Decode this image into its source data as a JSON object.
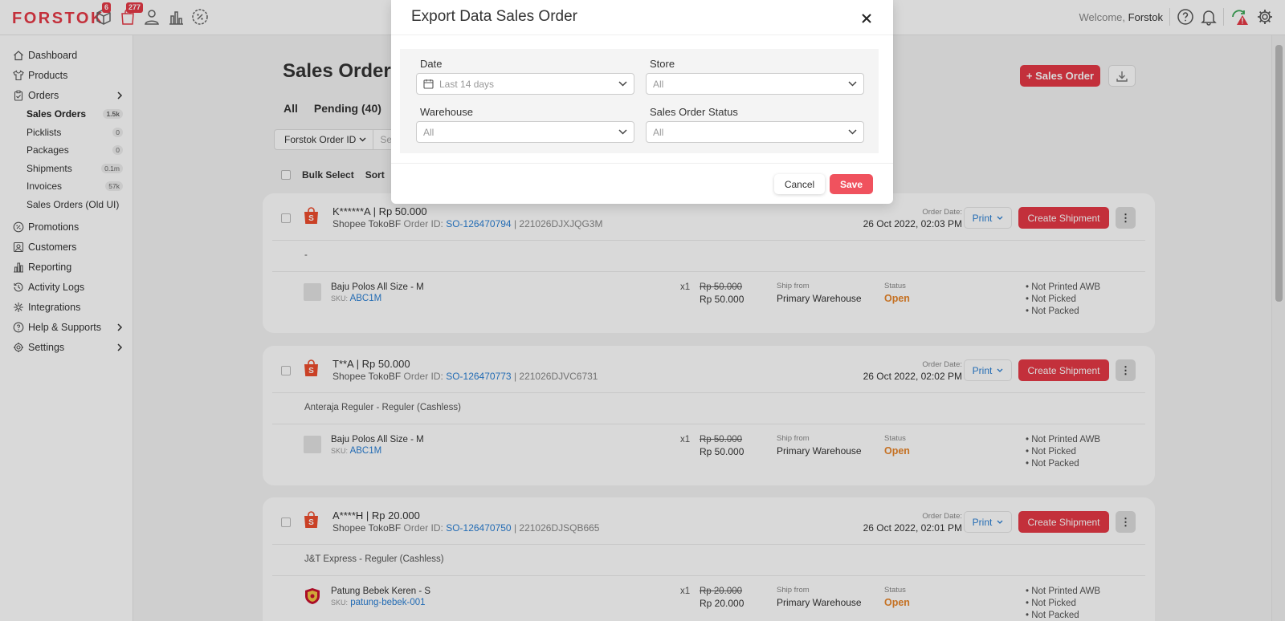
{
  "app": {
    "logo": "FORSTOK",
    "brand_color": "#e63946",
    "badges": {
      "box": "6",
      "bag": "277"
    },
    "welcome_prefix": "Welcome,",
    "welcome_user": "Forstok"
  },
  "sidebar": {
    "items": [
      {
        "label": "Dashboard",
        "icon": "home-icon"
      },
      {
        "label": "Products",
        "icon": "shirt-icon"
      },
      {
        "label": "Orders",
        "icon": "clipboard-icon"
      }
    ],
    "subitems": [
      {
        "label": "Sales Orders",
        "count": "1.5k"
      },
      {
        "label": "Picklists",
        "count": "0"
      },
      {
        "label": "Packages",
        "count": "0"
      },
      {
        "label": "Shipments",
        "count": "0.1m"
      },
      {
        "label": "Invoices",
        "count": "57k"
      },
      {
        "label": "Sales Orders (Old UI)",
        "count": ""
      }
    ],
    "items2": [
      {
        "label": "Promotions",
        "icon": "percent-icon"
      },
      {
        "label": "Customers",
        "icon": "user-card-icon"
      },
      {
        "label": "Reporting",
        "icon": "bar-chart-icon"
      },
      {
        "label": "Activity Logs",
        "icon": "history-icon"
      },
      {
        "label": "Integrations",
        "icon": "integration-icon"
      },
      {
        "label": "Help & Supports",
        "icon": "help-icon"
      },
      {
        "label": "Settings",
        "icon": "gear-icon"
      }
    ]
  },
  "main": {
    "title": "Sales Orders",
    "tabs": [
      "All",
      "Pending (40)"
    ],
    "filter_select": "Forstok Order ID",
    "search_placeholder": "Sea",
    "bulk_select": "Bulk Select",
    "sort": "Sort",
    "add_button": "+ Sales Order"
  },
  "orders": [
    {
      "buyer": "K******A | Rp 50.000",
      "store": "Shopee TokoBF",
      "order_id_label": "Order ID:",
      "so": "SO-126470794",
      "sep": " | ",
      "ref": "221026DJXJQG3M",
      "date_label": "Order Date:",
      "date": "26 Oct 2022, 02:03 PM",
      "courier": "-",
      "product": "Baju Polos All Size - M",
      "sku_label": "SKU:",
      "sku": "ABC1M",
      "qty": "x1",
      "price_old": "Rp 50.000",
      "price_new": "Rp 50.000",
      "ship_from_label": "Ship from",
      "ship_from": "Primary Warehouse",
      "status_label": "Status",
      "status": "Open",
      "flags": [
        "Not Printed AWB",
        "Not Picked",
        "Not Packed"
      ]
    },
    {
      "buyer": "T**A | Rp 50.000",
      "store": "Shopee TokoBF",
      "order_id_label": "Order ID:",
      "so": "SO-126470773",
      "sep": " | ",
      "ref": "221026DJVC6731",
      "date_label": "Order Date:",
      "date": "26 Oct 2022, 02:02 PM",
      "courier": "Anteraja Reguler - Reguler (Cashless)",
      "product": "Baju Polos All Size - M",
      "sku_label": "SKU:",
      "sku": "ABC1M",
      "qty": "x1",
      "price_old": "Rp 50.000",
      "price_new": "Rp 50.000",
      "ship_from_label": "Ship from",
      "ship_from": "Primary Warehouse",
      "status_label": "Status",
      "status": "Open",
      "flags": [
        "Not Printed AWB",
        "Not Picked",
        "Not Packed"
      ]
    },
    {
      "buyer": "A****H | Rp 20.000",
      "store": "Shopee TokoBF",
      "order_id_label": "Order ID:",
      "so": "SO-126470750",
      "sep": " | ",
      "ref": "221026DJSQB665",
      "date_label": "Order Date:",
      "date": "26 Oct 2022, 02:01 PM",
      "courier": "J&T Express - Reguler (Cashless)",
      "product": "Patung Bebek Keren - S",
      "sku_label": "SKU:",
      "sku": "patung-bebek-001",
      "qty": "x1",
      "price_old": "Rp 20.000",
      "price_new": "Rp 20.000",
      "ship_from_label": "Ship from",
      "ship_from": "Primary Warehouse",
      "status_label": "Status",
      "status": "Open",
      "flags": [
        "Not Printed AWB",
        "Not Picked",
        "Not Packed"
      ]
    }
  ],
  "order_actions": {
    "print": "Print",
    "create_shipment": "Create Shipment"
  },
  "modal": {
    "title": "Export Data Sales Order",
    "date_label": "Date",
    "date_value": "Last 14 days",
    "store_label": "Store",
    "store_value": "All",
    "warehouse_label": "Warehouse",
    "warehouse_value": "All",
    "status_label": "Sales Order Status",
    "status_value": "All",
    "cancel": "Cancel",
    "save": "Save"
  }
}
